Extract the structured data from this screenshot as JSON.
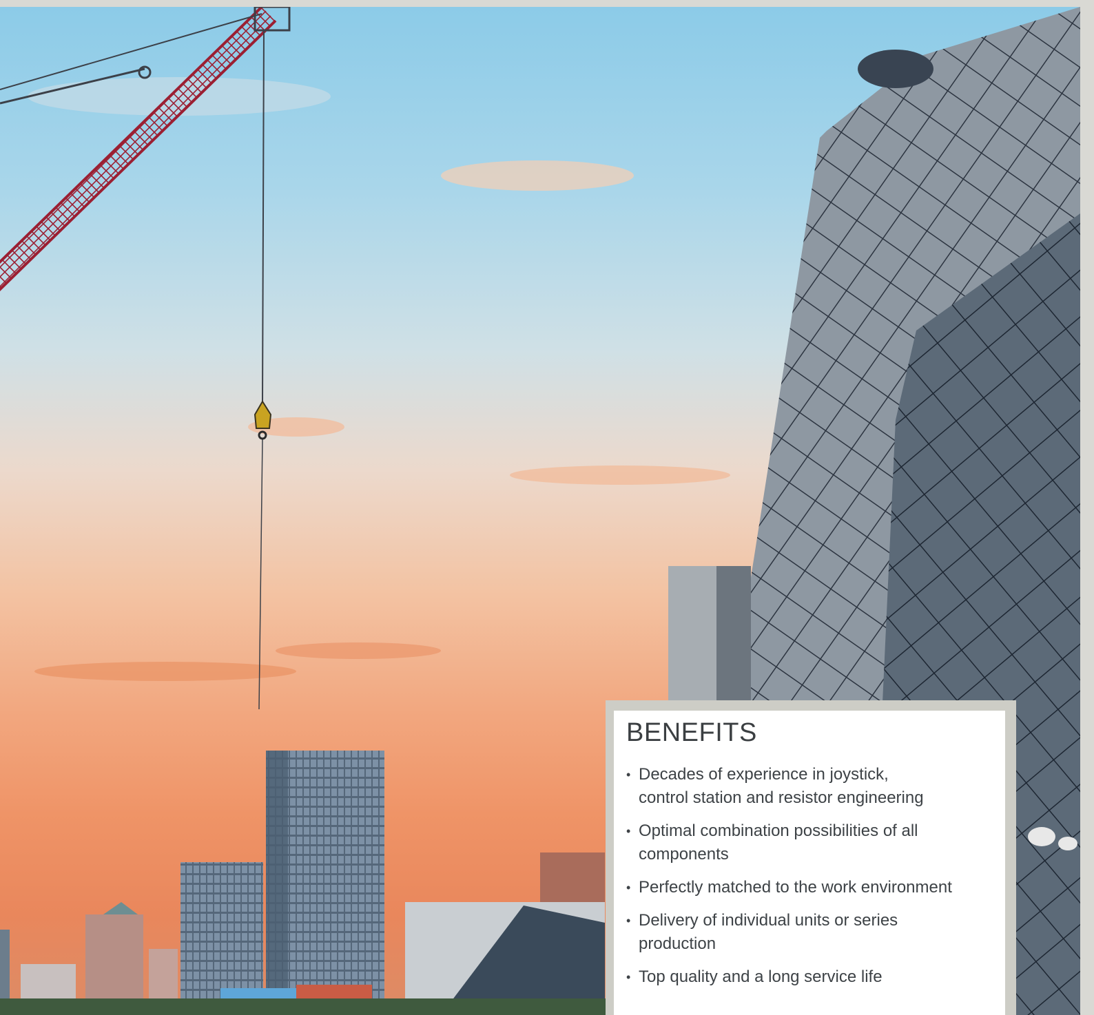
{
  "benefits": {
    "title": "BENEFITS",
    "items": [
      {
        "line1": "Decades of experience in joystick,",
        "line2": "control station and resistor engineering"
      },
      {
        "line1": "Optimal combination possibilities of all",
        "line2": "components"
      },
      {
        "line1": "Perfectly matched to the work environment",
        "line2": ""
      },
      {
        "line1": "Delivery of individual units or series",
        "line2": "production"
      },
      {
        "line1": "Top quality and a long service life",
        "line2": ""
      }
    ]
  },
  "colors": {
    "accent_frame": "#cdcdc6",
    "card_background": "#ffffff",
    "text": "#3d4246",
    "crane_red": "#9b1f32",
    "hook_yellow": "#c9a321"
  },
  "icons": [
    "crane-illustration",
    "hook-block-icon"
  ]
}
